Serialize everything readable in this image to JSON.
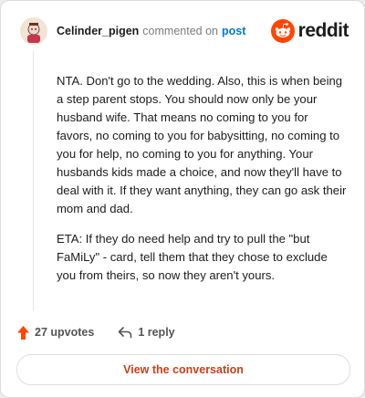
{
  "header": {
    "username": "Celinder_pigen",
    "action_text": "commented on",
    "post_link": "post",
    "brand": "reddit"
  },
  "comment": {
    "paragraphs": [
      "NTA. Don't go to the wedding. Also, this is when being a step parent stops. You should now only be your husband wife. That means no coming to you for favors, no coming to you for babysitting, no coming to you for help, no coming to you for anything. Your husbands kids made a choice, and now they'll have to deal with it. If they want anything, they can go ask their mom and dad.",
      "ETA: If they do need help and try to pull the \"but FaMiLy\" - card, tell them that they chose to exclude you from theirs, so now they aren't yours."
    ]
  },
  "footer": {
    "upvotes_label": "27 upvotes",
    "replies_label": "1 reply",
    "cta_label": "View the conversation"
  },
  "icons": {
    "avatar": "user-avatar",
    "brand": "reddit-snoo-icon",
    "upvote": "upvote-arrow-icon",
    "reply": "reply-arrow-icon"
  },
  "colors": {
    "brand_orange": "#ff4500",
    "link_blue": "#0079d3",
    "cta_text": "#c9401a"
  }
}
